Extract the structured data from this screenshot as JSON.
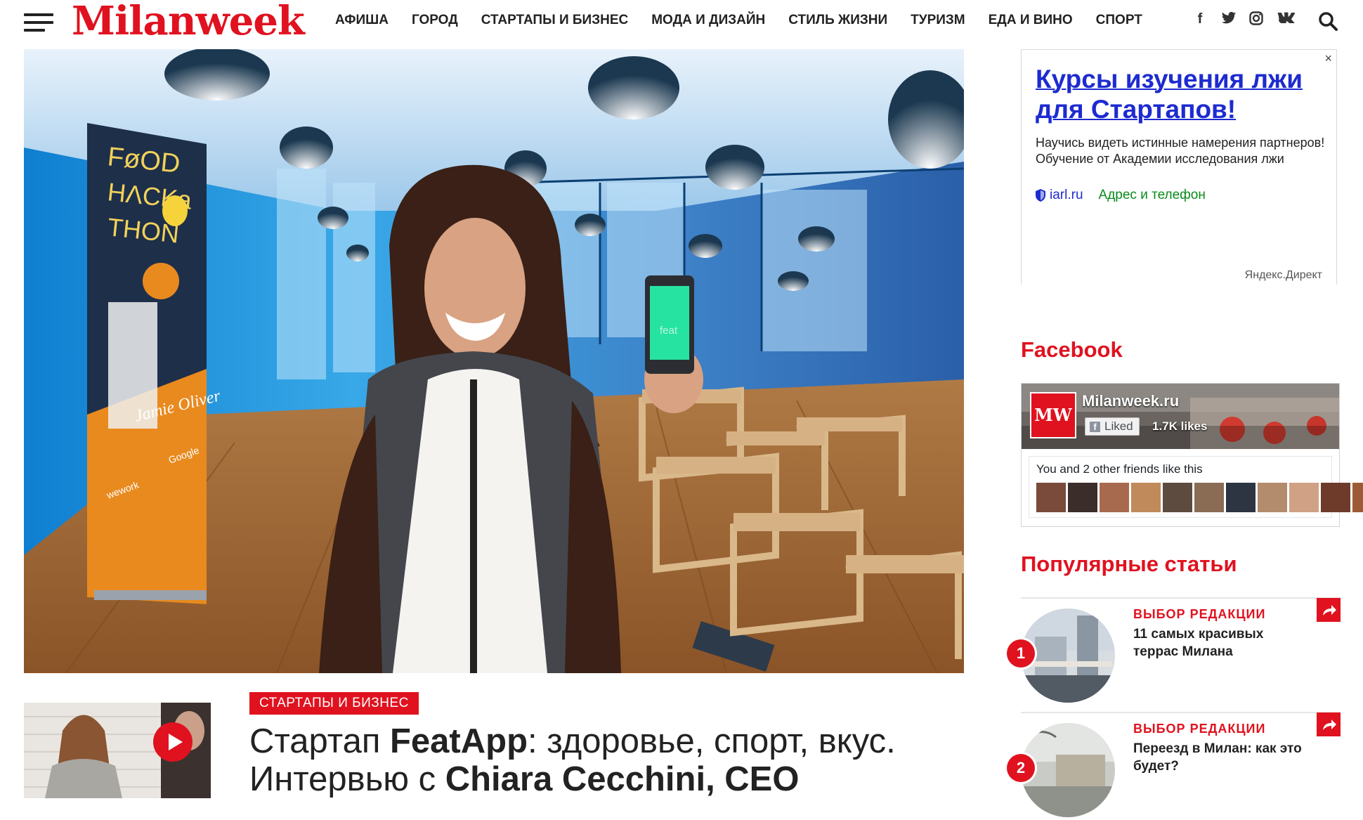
{
  "site": {
    "logo": "Milanweek",
    "nav": [
      "АФИША",
      "ГОРОД",
      "СТАРТАПЫ И БИЗНЕС",
      "МОДА И ДИЗАЙН",
      "СТИЛЬ ЖИЗНИ",
      "ТУРИЗМ",
      "ЕДА И ВИНО",
      "СПОРТ"
    ],
    "social": {
      "facebook": "f",
      "twitter": "twitter-icon",
      "instagram": "instagram-icon",
      "vk": "vk-icon"
    },
    "accent_color": "#e0121f"
  },
  "hero": {
    "banner_text": [
      "FøOD",
      "HΛCKa",
      "THON"
    ],
    "banner_name": "Jamie Oliver",
    "banner_sponsors": [
      "wework",
      "Google"
    ],
    "phone_screen": "feat"
  },
  "article": {
    "category": "СТАРТАПЫ И БИЗНЕС",
    "title_line1_a": "Стартап ",
    "title_line1_b": "FeatApp",
    "title_line1_c": ": здоровье, спорт, вкус.",
    "title_line2_a": "Интервью с ",
    "title_line2_b": "Chiara Cecchini, CEO"
  },
  "ad": {
    "close": "×",
    "title": "Курсы изучения лжи для Стартапов!",
    "text": "Научись видеть истинные намерения парт­неров! Обучение от Академии иссле­дования лжи",
    "domain": "iarl.ru",
    "contact": "Адрес и телефон",
    "provider": "Яндекс.Директ"
  },
  "facebook": {
    "section_title": "Facebook",
    "logo": "MW",
    "page_name": "Milanweek.ru",
    "liked_label": "Liked",
    "likes": "1.7K likes",
    "friends_text": "You and 2 other friends like this",
    "avatar_colors": [
      "#7a4a3a",
      "#3b2d2a",
      "#a86a4e",
      "#c08a5a",
      "#5e4b3f",
      "#8a6c55",
      "#2d3442",
      "#b38b6d",
      "#d0a184",
      "#6e3b2b",
      "#9c5b34",
      "#c9633a"
    ]
  },
  "popular": {
    "section_title": "Популярные статьи",
    "items": [
      {
        "num": "1",
        "kicker": "ВЫБОР РЕДАКЦИИ",
        "title": "11 самых красивых террас Милана"
      },
      {
        "num": "2",
        "kicker": "ВЫБОР РЕДАКЦИИ",
        "title": "Переезд в Милан: как это будет?"
      }
    ]
  }
}
